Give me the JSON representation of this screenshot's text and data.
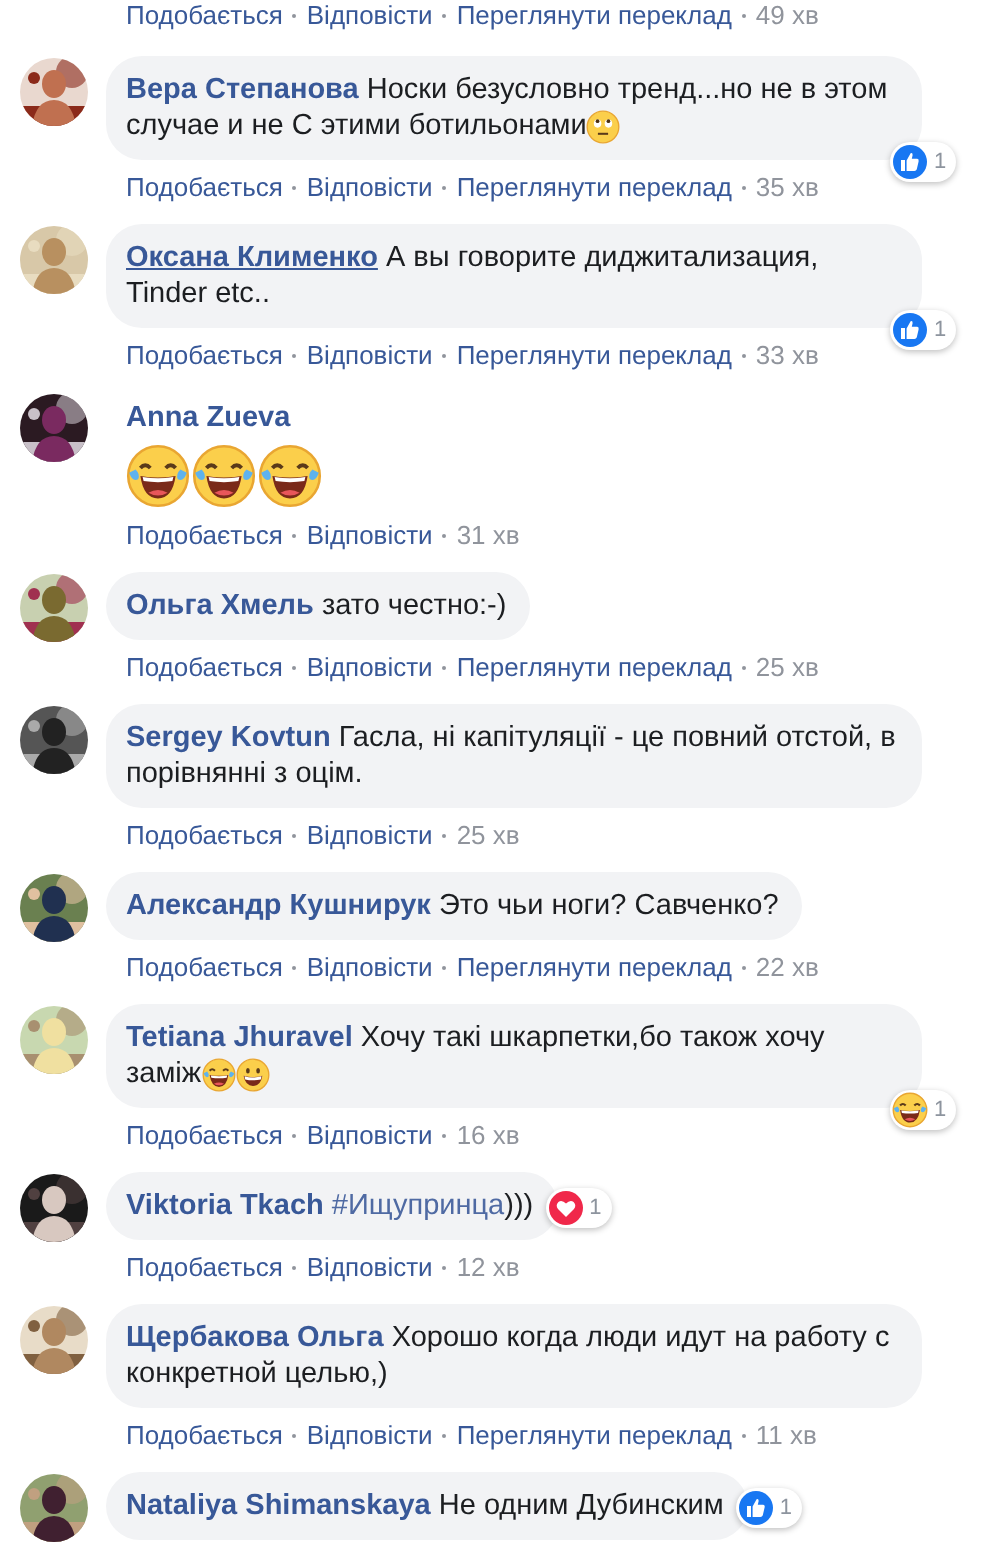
{
  "previous_actions": {
    "actions": [
      "Подобається",
      "Відповісти",
      "Переглянути переклад"
    ],
    "time": "49 хв"
  },
  "comments": [
    {
      "author": "Вера Степанова",
      "hover": false,
      "text": "Носки безусловно тренд...но не в этом случае и не С этими ботильонами",
      "emojis": [
        {
          "kind": "eye-roll"
        }
      ],
      "reaction": {
        "kind": "like",
        "count": "1"
      },
      "actions": [
        "Подобається",
        "Відповісти",
        "Переглянути переклад"
      ],
      "time": "35 хв"
    },
    {
      "author": "Оксана Клименко",
      "hover": true,
      "text": "А вы говорите диджитализация, Tinder etc..",
      "reaction": {
        "kind": "like",
        "count": "1"
      },
      "actions": [
        "Подобається",
        "Відповісти",
        "Переглянути переклад"
      ],
      "time": "33 хв"
    },
    {
      "author": "Anna Zueva",
      "hover": false,
      "big_emojis": [
        {
          "kind": "laugh"
        },
        {
          "kind": "laugh"
        },
        {
          "kind": "laugh"
        }
      ],
      "actions": [
        "Подобається",
        "Відповісти"
      ],
      "time": "31 хв"
    },
    {
      "author": "Ольга Хмель",
      "hover": false,
      "text": "зато честно:-)",
      "actions": [
        "Подобається",
        "Відповісти",
        "Переглянути переклад"
      ],
      "time": "25 хв"
    },
    {
      "author": "Sergey Kovtun",
      "hover": false,
      "text": "Гасла, ні капітуляції - це повний отстой, в порівнянні з оцім.",
      "actions": [
        "Подобається",
        "Відповісти"
      ],
      "time": "25 хв"
    },
    {
      "author": "Александр Кушнирук",
      "hover": false,
      "text": "Это чьи ноги? Савченко?",
      "actions": [
        "Подобається",
        "Відповісти",
        "Переглянути переклад"
      ],
      "time": "22 хв"
    },
    {
      "author": "Tetiana Jhuravel",
      "hover": false,
      "text": "Хочу такі шкарпетки,бо також хочу заміж",
      "emojis": [
        {
          "kind": "laugh"
        },
        {
          "kind": "grin"
        }
      ],
      "reaction": {
        "kind": "haha",
        "count": "1"
      },
      "actions": [
        "Подобається",
        "Відповісти"
      ],
      "time": "16 хв"
    },
    {
      "author": "Viktoria Tkach",
      "hover": false,
      "hashtag": "#Ищупринца",
      "text": ")))",
      "reaction": {
        "kind": "love",
        "count": "1"
      },
      "actions": [
        "Подобається",
        "Відповісти"
      ],
      "time": "12 хв"
    },
    {
      "author": "Щербакова Ольга",
      "hover": false,
      "text": "Хорошо когда люди идут на работу с конкретной целью,)",
      "actions": [
        "Подобається",
        "Відповісти",
        "Переглянути переклад"
      ],
      "time": "11 хв"
    },
    {
      "author": "Nataliya Shimanskaya",
      "hover": false,
      "text": "Не одним Дубинским",
      "reaction": {
        "kind": "like",
        "count": "1"
      }
    }
  ]
}
